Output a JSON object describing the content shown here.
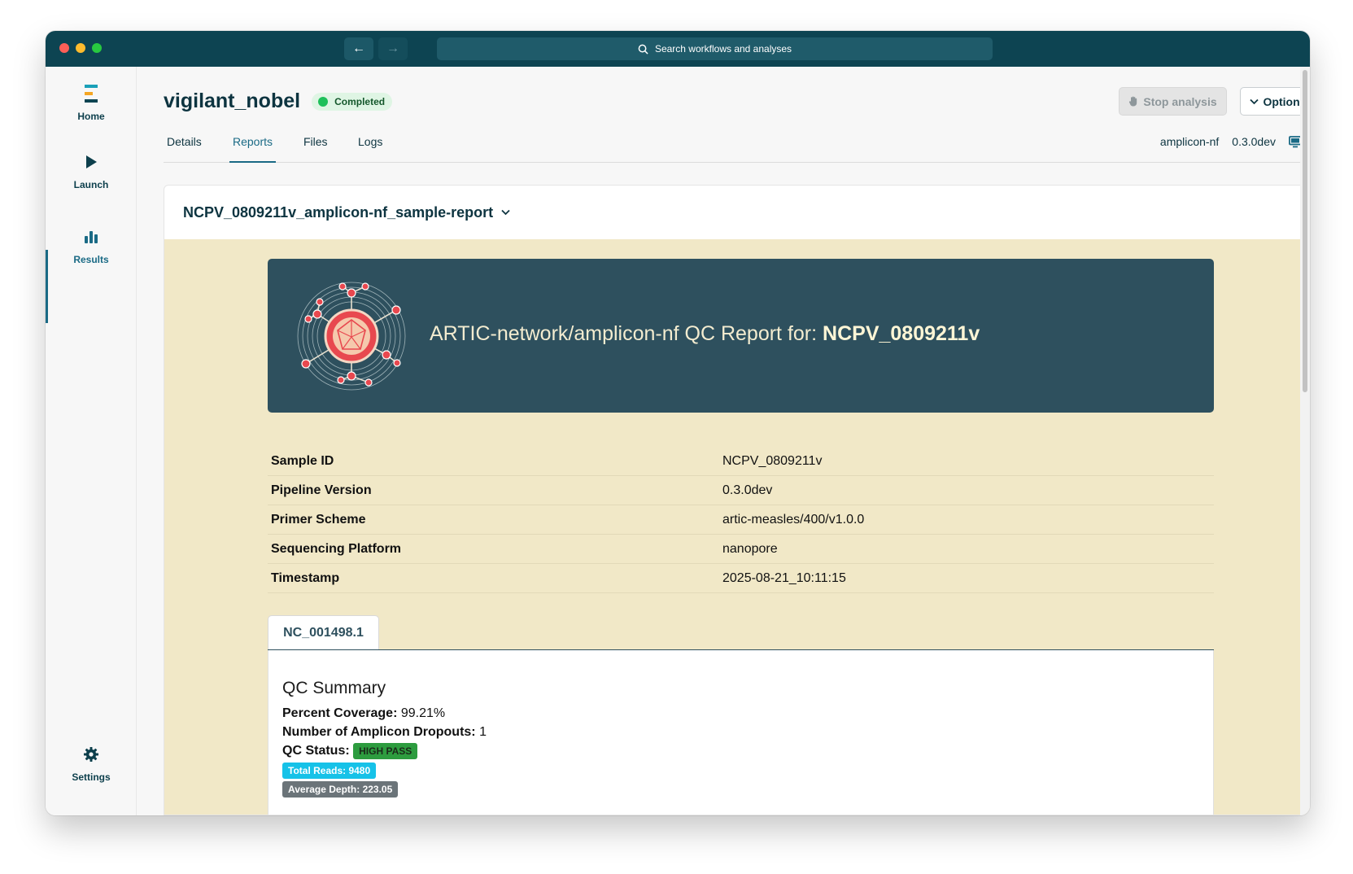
{
  "window": {
    "search_placeholder": "Search workflows and analyses"
  },
  "sidebar": {
    "items": [
      {
        "label": "Home",
        "icon": "home-logo-icon"
      },
      {
        "label": "Launch",
        "icon": "play-icon"
      },
      {
        "label": "Results",
        "icon": "bar-chart-icon",
        "active": true
      },
      {
        "label": "Settings",
        "icon": "gear-icon"
      }
    ]
  },
  "header": {
    "title": "vigilant_nobel",
    "status": "Completed",
    "stop_label": "Stop analysis",
    "options_label": "Options"
  },
  "tabs": [
    {
      "label": "Details"
    },
    {
      "label": "Reports",
      "active": true
    },
    {
      "label": "Files"
    },
    {
      "label": "Logs"
    }
  ],
  "workflow": {
    "name": "amplicon-nf",
    "version": "0.3.0dev"
  },
  "report": {
    "selector_label": "NCPV_0809211v_amplicon-nf_sample-report",
    "banner_prefix": "ARTIC-network/amplicon-nf QC Report for:",
    "banner_sample": "NCPV_0809211v",
    "info": [
      {
        "key": "Sample ID",
        "value": "NCPV_0809211v"
      },
      {
        "key": "Pipeline Version",
        "value": "0.3.0dev"
      },
      {
        "key": "Primer Scheme",
        "value": "artic-measles/400/v1.0.0"
      },
      {
        "key": "Sequencing Platform",
        "value": "nanopore"
      },
      {
        "key": "Timestamp",
        "value": "2025-08-21_10:11:15"
      }
    ],
    "contig_tab": "NC_001498.1",
    "qc": {
      "title": "QC Summary",
      "coverage_label": "Percent Coverage:",
      "coverage_value": "99.21%",
      "dropouts_label": "Number of Amplicon Dropouts:",
      "dropouts_value": "1",
      "status_label": "QC Status:",
      "status_value": "HIGH PASS",
      "total_reads": "Total Reads: 9480",
      "average_depth": "Average Depth: 223.05"
    }
  },
  "colors": {
    "titlebar": "#0d4452",
    "accent": "#1a6a85",
    "banner": "#2e505e",
    "report_bg": "#f1e8c7",
    "status_green": "#1ec05a"
  }
}
